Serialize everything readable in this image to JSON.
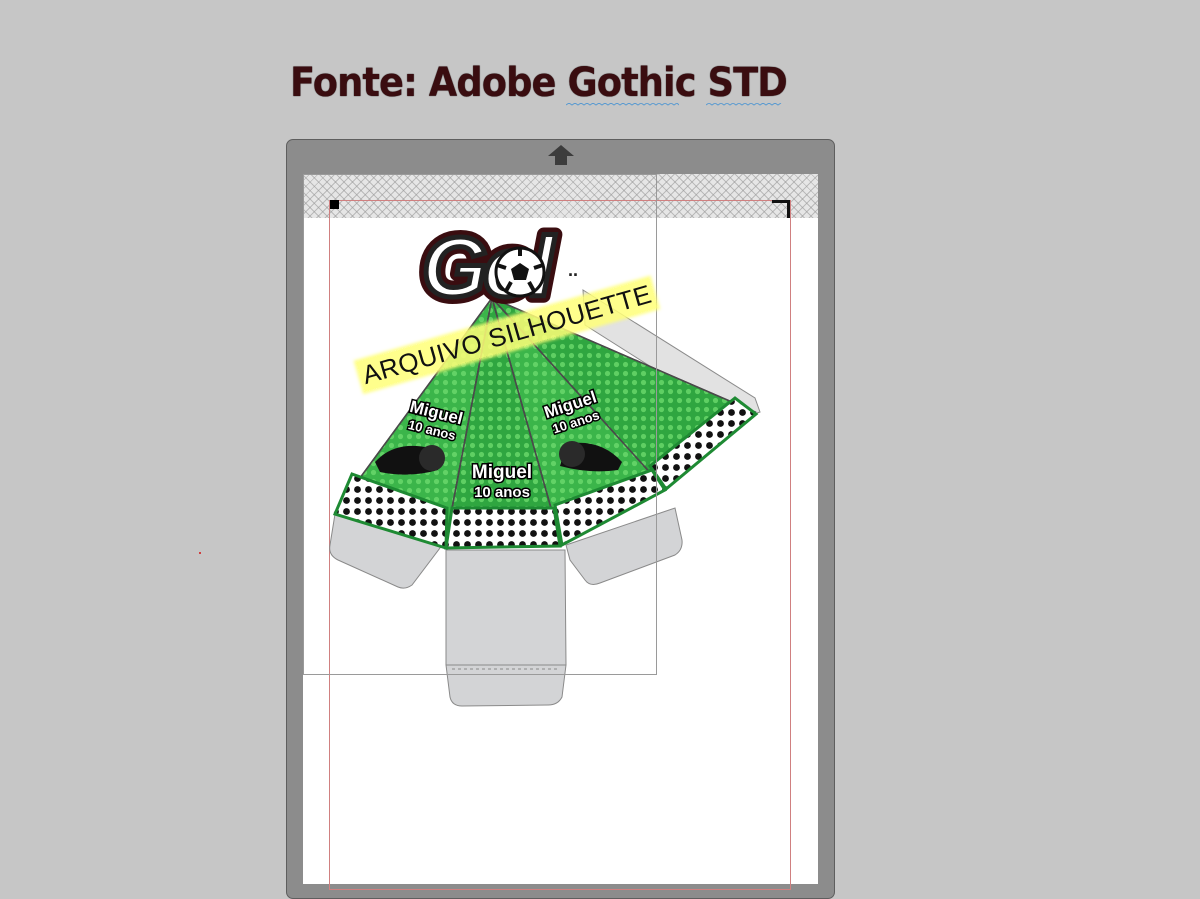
{
  "heading": {
    "text": "Fonte: Adobe Gothic STD"
  },
  "logo": {
    "text": "Gol"
  },
  "labels": {
    "name": "Miguel",
    "age": "10 anos"
  },
  "watermark": {
    "text": "ARQUIVO SILHOUETTE"
  },
  "icons": {
    "feed": "arrow-up-icon",
    "ball": "soccer-ball-icon"
  },
  "colors": {
    "background": "#c6c6c6",
    "mat": "#8c8c8c",
    "panel_green": "#3bb54a",
    "panel_dark_green": "#1e8a33",
    "tab_gray": "#d3d4d6",
    "highlight": "#ffff78",
    "heading": "#3a0d10"
  }
}
